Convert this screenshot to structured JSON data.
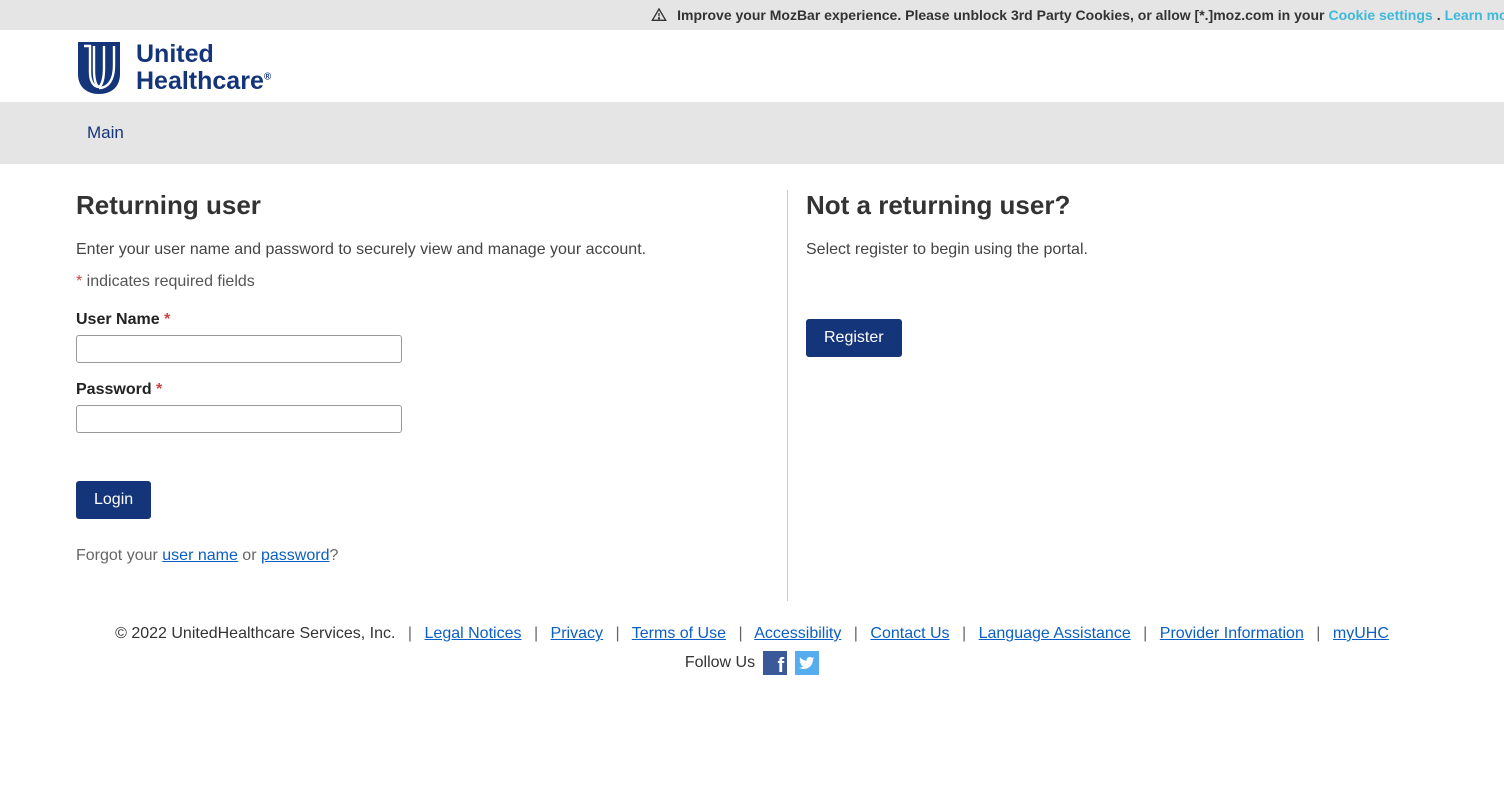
{
  "mozbar": {
    "text_before": "Improve your MozBar experience. Please unblock 3rd Party Cookies, or allow [*.]moz.com in your ",
    "cookie_link": "Cookie settings",
    "dot": ". ",
    "learn_more": "Learn more"
  },
  "brand": {
    "line1": "United",
    "line2": "Healthcare"
  },
  "nav": {
    "main": "Main"
  },
  "login": {
    "heading": "Returning user",
    "intro": "Enter your user name and password to securely view and manage your account.",
    "required_note": " indicates required fields",
    "asterisk": "*",
    "username_label": "User Name",
    "password_label": "Password",
    "button": "Login",
    "forgot_prefix": "Forgot your ",
    "forgot_user": "user name",
    "forgot_or": " or ",
    "forgot_password": "password",
    "forgot_suffix": "?"
  },
  "register": {
    "heading": "Not a returning user?",
    "intro": "Select register to begin using the portal.",
    "button": "Register"
  },
  "footer": {
    "copyright": "© 2022 UnitedHealthcare Services, Inc.",
    "links": {
      "legal": "Legal Notices",
      "privacy": "Privacy",
      "terms": "Terms of Use",
      "accessibility": "Accessibility",
      "contact": "Contact Us",
      "language": "Language Assistance",
      "provider": "Provider Information",
      "myuhc": "myUHC"
    },
    "follow": "Follow Us"
  }
}
